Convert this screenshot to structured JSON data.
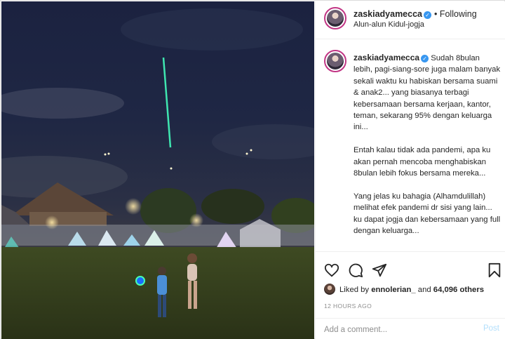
{
  "post": {
    "username": "zaskiadyamecca",
    "follow_status": "• Following",
    "location": "Alun-alun Kidul-jogja",
    "caption": {
      "username": "zaskiadyamecca",
      "text": " Sudah 8bulan lebih, pagi-siang-sore juga malam banyak sekali waktu ku habiskan bersama suami & anak2... yang biasanya terbagi kebersamaan bersama kerjaan, kantor, teman, sekarang 95% dengan keluarga ini...\n\nEntah kalau tidak ada pandemi, apa ku akan pernah mencoba menghabiskan 8bulan lebih fokus bersama mereka...\n\nYang jelas ku bahagia (Alhamdulillah) melihat efek pandemi dr sisi yang lain... ku dapat jogja dan kebersamaan yang full dengan keluarga...\n\nTapi satu yang hilang terasa berat sekali, hrs jauh dan jarang ketemu"
    },
    "likes": {
      "prefix": "Liked by",
      "liker": "ennolerian_",
      "joiner": "and",
      "others": "64,096 others"
    },
    "time": "12 HOURS AGO",
    "comment_placeholder": "Add a comment...",
    "post_button": "Post"
  },
  "icons": {
    "verified": "verified-badge",
    "like": "heart-icon",
    "comment": "comment-icon",
    "share": "share-icon",
    "save": "bookmark-icon"
  },
  "colors": {
    "verified": "#3897f0",
    "post_disabled": "#b2dffc",
    "muted": "#8e8e8e",
    "text": "#262626"
  }
}
